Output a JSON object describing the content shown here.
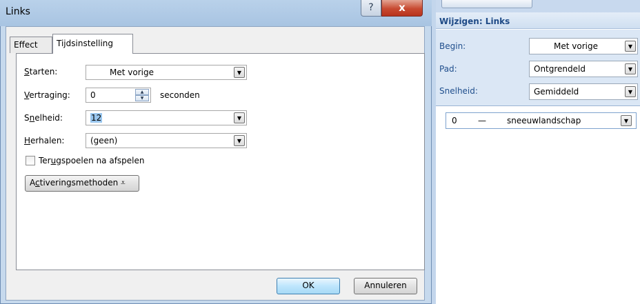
{
  "dialog": {
    "title": "Links",
    "help_glyph": "?",
    "close_glyph": "x",
    "tabs": [
      {
        "label": "Effect",
        "active": false
      },
      {
        "label": "Tijdsinstelling",
        "active": true
      }
    ],
    "fields": {
      "start": {
        "label": "Starten:",
        "accel": "S",
        "rest": "tarten:",
        "value": "Met vorige"
      },
      "delay": {
        "label": "Vertraging:",
        "accel": "V",
        "rest": "ertraging:",
        "value": "0",
        "unit": "seconden"
      },
      "speed": {
        "label": "Snelheid:",
        "pre": "S",
        "accel": "n",
        "rest": "elheid:",
        "value": "12"
      },
      "repeat": {
        "label": "Herhalen:",
        "accel": "H",
        "rest": "erhalen:",
        "value": "(geen)"
      }
    },
    "rewind": {
      "label": "Terugspoelen na afspelen",
      "pre": "Ter",
      "accel": "u",
      "rest": "gspoelen na afspelen",
      "checked": false
    },
    "triggers_button": {
      "label": "Activeringsmethoden",
      "pre": "A",
      "accel": "c",
      "rest": "tiveringsmethoden",
      "glyph": "⩡"
    },
    "ok_label": "OK",
    "cancel_label": "Annuleren"
  },
  "pane": {
    "title": "Wijzigen: Links",
    "begin": {
      "label": "Begin:",
      "value": "Met vorige"
    },
    "path": {
      "label": "Pad:",
      "value": "Ontgrendeld"
    },
    "speed": {
      "label": "Snelheid:",
      "value": "Gemiddeld"
    },
    "item": {
      "index": "0",
      "dash": "—",
      "name": "sneeuwlandschap"
    }
  },
  "icons": {
    "dropdown": "chevron-down-icon",
    "spin_up": "arrow-up-icon",
    "spin_down": "arrow-down-icon"
  }
}
